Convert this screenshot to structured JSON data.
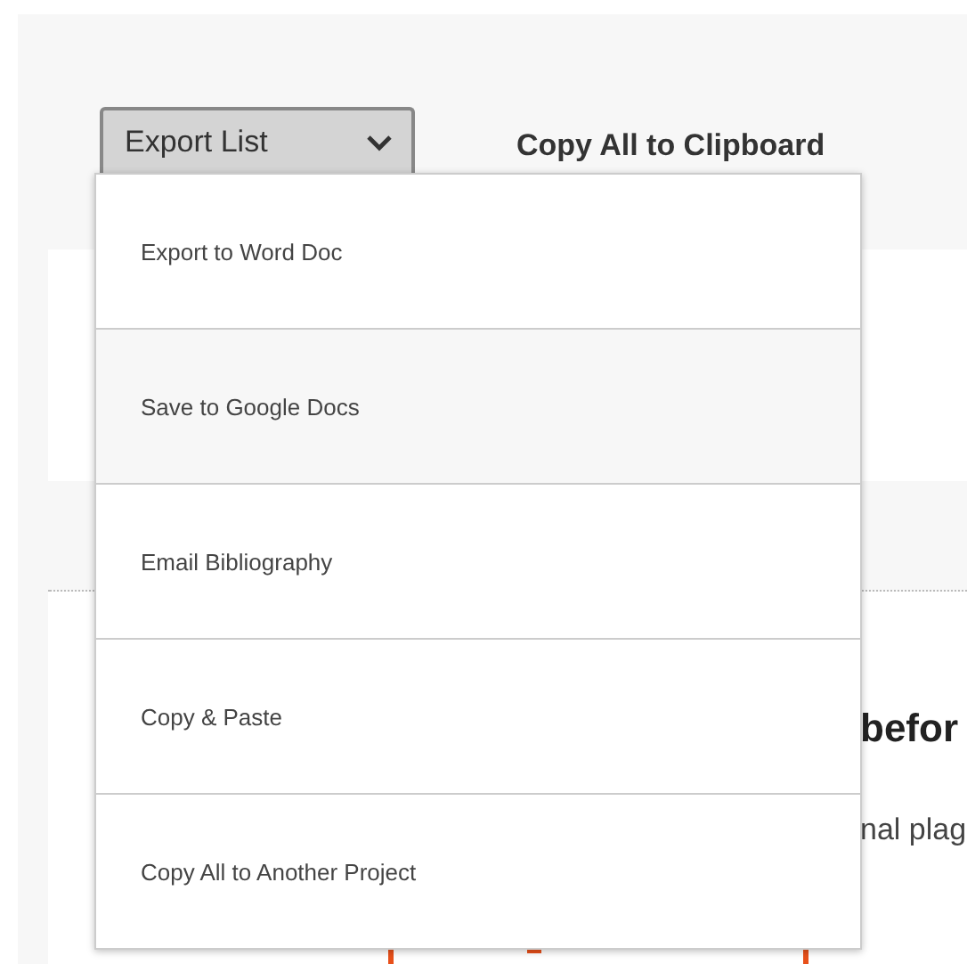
{
  "toolbar": {
    "export_button": {
      "label": "Export List",
      "expanded": true
    },
    "copy_link": "Copy All to Clipboard"
  },
  "export_menu": [
    {
      "label": "Export to Word Doc",
      "selected": false
    },
    {
      "label": "Save to Google Docs",
      "selected": true
    },
    {
      "label": "Email Bibliography",
      "selected": false
    },
    {
      "label": "Copy & Paste",
      "selected": false
    },
    {
      "label": "Copy All to Another Project",
      "selected": false
    }
  ],
  "card": {
    "heading": "befor",
    "text": "nal plag"
  }
}
